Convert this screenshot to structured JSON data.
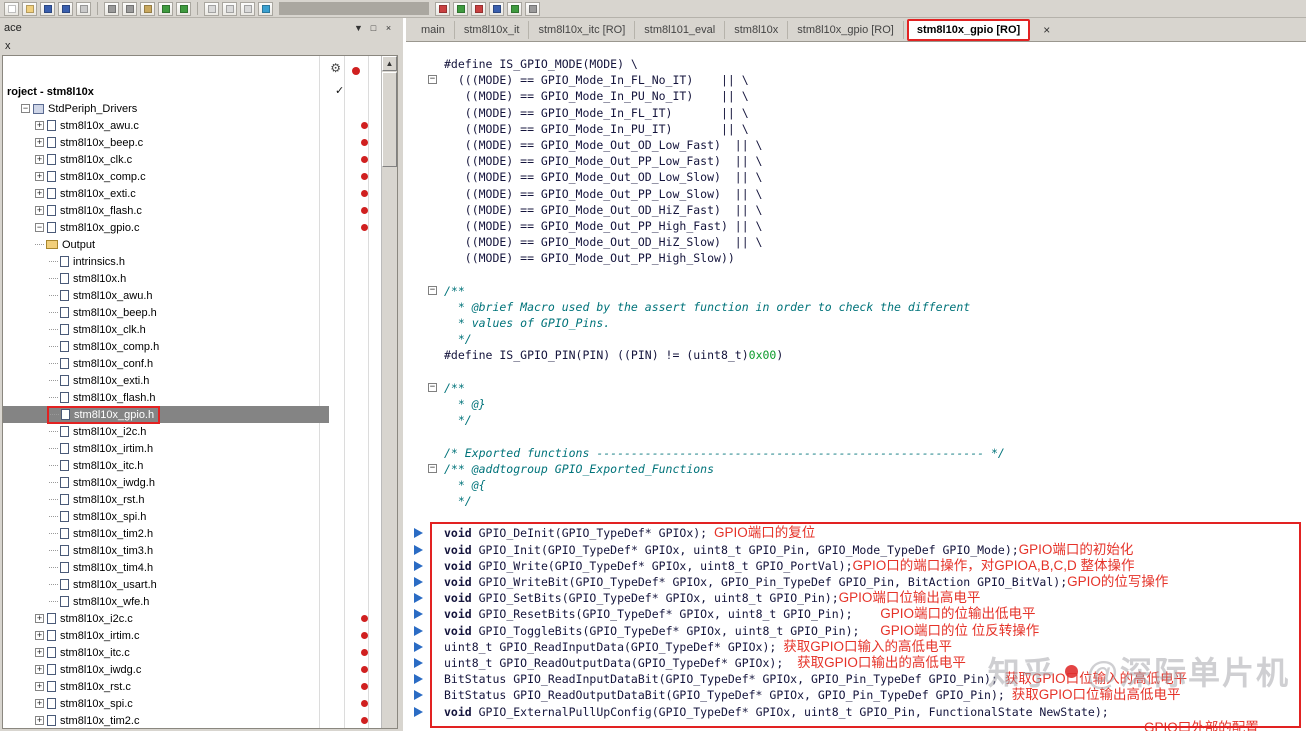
{
  "icons": {
    "dropdown": "▼",
    "pin": "□",
    "close": "×",
    "gear": "⚙",
    "check": "✓",
    "scroll_up": "▲",
    "tab_close": "×"
  },
  "toolbar": {
    "groups": [
      {
        "icons": [
          {
            "n": "new-document-icon",
            "c": "#ffffff"
          },
          {
            "n": "open-file-icon",
            "c": "#f0cf7e"
          },
          {
            "n": "save-icon",
            "c": "#3a5fae"
          },
          {
            "n": "save-all-icon",
            "c": "#3a5fae"
          },
          {
            "n": "print-icon",
            "c": "#c9c9c9"
          }
        ]
      },
      {
        "icons": [
          {
            "n": "cut-icon",
            "c": "#9a9a9a"
          },
          {
            "n": "copy-icon",
            "c": "#9a9a9a"
          },
          {
            "n": "paste-icon",
            "c": "#c9a85e"
          },
          {
            "n": "undo-icon",
            "c": "#3f9b3f"
          },
          {
            "n": "redo-icon",
            "c": "#3f9b3f"
          }
        ]
      },
      {
        "icons": [
          {
            "n": "find-icon",
            "c": "#d9d9d9"
          },
          {
            "n": "replace-icon",
            "c": "#d9d9d9"
          },
          {
            "n": "find-next-icon",
            "c": "#d9d9d9"
          },
          {
            "n": "bookmark-icon",
            "c": "#3aa0d0"
          }
        ]
      },
      {
        "gap": true,
        "icons": [
          {
            "n": "make-build-icon",
            "c": "#c94040"
          },
          {
            "n": "compile-icon",
            "c": "#3f9b3f"
          },
          {
            "n": "stop-build-icon",
            "c": "#c94040"
          },
          {
            "n": "download-debug-icon",
            "c": "#3a5fae"
          },
          {
            "n": "debug-icon",
            "c": "#3f9b3f"
          },
          {
            "n": "settings-icon",
            "c": "#9a9a9a"
          }
        ]
      }
    ]
  },
  "workspace": {
    "panel_title": "ace",
    "sub_label": "x",
    "tree": [
      {
        "label": "roject - stm8l10x",
        "depth": 0,
        "box": "",
        "icon": "",
        "bold": true,
        "check": true
      },
      {
        "label": "StdPeriph_Drivers",
        "depth": 1,
        "box": "-",
        "icon": "group"
      },
      {
        "label": "stm8l10x_awu.c",
        "depth": 2,
        "box": "+",
        "icon": "file",
        "dot": true
      },
      {
        "label": "stm8l10x_beep.c",
        "depth": 2,
        "box": "+",
        "icon": "file",
        "dot": true
      },
      {
        "label": "stm8l10x_clk.c",
        "depth": 2,
        "box": "+",
        "icon": "file",
        "dot": true
      },
      {
        "label": "stm8l10x_comp.c",
        "depth": 2,
        "box": "+",
        "icon": "file",
        "dot": true
      },
      {
        "label": "stm8l10x_exti.c",
        "depth": 2,
        "box": "+",
        "icon": "file",
        "dot": true
      },
      {
        "label": "stm8l10x_flash.c",
        "depth": 2,
        "box": "+",
        "icon": "file",
        "dot": true
      },
      {
        "label": "stm8l10x_gpio.c",
        "depth": 2,
        "box": "-",
        "icon": "file",
        "dot": true
      },
      {
        "label": "Output",
        "depth": 2,
        "box": "",
        "icon": "folder"
      },
      {
        "label": "intrinsics.h",
        "depth": 3,
        "box": "",
        "icon": "file"
      },
      {
        "label": "stm8l10x.h",
        "depth": 3,
        "box": "",
        "icon": "file"
      },
      {
        "label": "stm8l10x_awu.h",
        "depth": 3,
        "box": "",
        "icon": "file"
      },
      {
        "label": "stm8l10x_beep.h",
        "depth": 3,
        "box": "",
        "icon": "file"
      },
      {
        "label": "stm8l10x_clk.h",
        "depth": 3,
        "box": "",
        "icon": "file"
      },
      {
        "label": "stm8l10x_comp.h",
        "depth": 3,
        "box": "",
        "icon": "file"
      },
      {
        "label": "stm8l10x_conf.h",
        "depth": 3,
        "box": "",
        "icon": "file"
      },
      {
        "label": "stm8l10x_exti.h",
        "depth": 3,
        "box": "",
        "icon": "file"
      },
      {
        "label": "stm8l10x_flash.h",
        "depth": 3,
        "box": "",
        "icon": "file"
      },
      {
        "label": "stm8l10x_gpio.h",
        "depth": 3,
        "box": "",
        "icon": "file",
        "sel": true,
        "redbox": true
      },
      {
        "label": "stm8l10x_i2c.h",
        "depth": 3,
        "box": "",
        "icon": "file"
      },
      {
        "label": "stm8l10x_irtim.h",
        "depth": 3,
        "box": "",
        "icon": "file"
      },
      {
        "label": "stm8l10x_itc.h",
        "depth": 3,
        "box": "",
        "icon": "file"
      },
      {
        "label": "stm8l10x_iwdg.h",
        "depth": 3,
        "box": "",
        "icon": "file"
      },
      {
        "label": "stm8l10x_rst.h",
        "depth": 3,
        "box": "",
        "icon": "file"
      },
      {
        "label": "stm8l10x_spi.h",
        "depth": 3,
        "box": "",
        "icon": "file"
      },
      {
        "label": "stm8l10x_tim2.h",
        "depth": 3,
        "box": "",
        "icon": "file"
      },
      {
        "label": "stm8l10x_tim3.h",
        "depth": 3,
        "box": "",
        "icon": "file"
      },
      {
        "label": "stm8l10x_tim4.h",
        "depth": 3,
        "box": "",
        "icon": "file"
      },
      {
        "label": "stm8l10x_usart.h",
        "depth": 3,
        "box": "",
        "icon": "file"
      },
      {
        "label": "stm8l10x_wfe.h",
        "depth": 3,
        "box": "",
        "icon": "file"
      },
      {
        "label": "stm8l10x_i2c.c",
        "depth": 2,
        "box": "+",
        "icon": "file",
        "dot": true
      },
      {
        "label": "stm8l10x_irtim.c",
        "depth": 2,
        "box": "+",
        "icon": "file",
        "dot": true
      },
      {
        "label": "stm8l10x_itc.c",
        "depth": 2,
        "box": "+",
        "icon": "file",
        "dot": true
      },
      {
        "label": "stm8l10x_iwdg.c",
        "depth": 2,
        "box": "+",
        "icon": "file",
        "dot": true
      },
      {
        "label": "stm8l10x_rst.c",
        "depth": 2,
        "box": "+",
        "icon": "file",
        "dot": true
      },
      {
        "label": "stm8l10x_spi.c",
        "depth": 2,
        "box": "+",
        "icon": "file",
        "dot": true
      },
      {
        "label": "stm8l10x_tim2.c",
        "depth": 2,
        "box": "+",
        "icon": "file",
        "dot": true
      }
    ]
  },
  "editor": {
    "tabs": [
      {
        "label": "main"
      },
      {
        "label": "stm8l10x_it"
      },
      {
        "label": "stm8l10x_itc [RO]"
      },
      {
        "label": "stm8l101_eval"
      },
      {
        "label": "stm8l10x"
      },
      {
        "label": "stm8l10x_gpio [RO]"
      },
      {
        "label": "stm8l10x_gpio [RO]",
        "active": true
      }
    ],
    "lines": [
      {
        "g": "",
        "s": [
          [
            "#define IS_GPIO_MODE(MODE) \\",
            "c"
          ]
        ]
      },
      {
        "g": "fold",
        "s": [
          [
            "  (((MODE) == GPIO_Mode_In_FL_No_IT)    || \\",
            "c"
          ]
        ]
      },
      {
        "g": "",
        "s": [
          [
            "   ((MODE) == GPIO_Mode_In_PU_No_IT)    || \\",
            "c"
          ]
        ]
      },
      {
        "g": "",
        "s": [
          [
            "   ((MODE) == GPIO_Mode_In_FL_IT)       || \\",
            "c"
          ]
        ]
      },
      {
        "g": "",
        "s": [
          [
            "   ((MODE) == GPIO_Mode_In_PU_IT)       || \\",
            "c"
          ]
        ]
      },
      {
        "g": "",
        "s": [
          [
            "   ((MODE) == GPIO_Mode_Out_OD_Low_Fast)  || \\",
            "c"
          ]
        ]
      },
      {
        "g": "",
        "s": [
          [
            "   ((MODE) == GPIO_Mode_Out_PP_Low_Fast)  || \\",
            "c"
          ]
        ]
      },
      {
        "g": "",
        "s": [
          [
            "   ((MODE) == GPIO_Mode_Out_OD_Low_Slow)  || \\",
            "c"
          ]
        ]
      },
      {
        "g": "",
        "s": [
          [
            "   ((MODE) == GPIO_Mode_Out_PP_Low_Slow)  || \\",
            "c"
          ]
        ]
      },
      {
        "g": "",
        "s": [
          [
            "   ((MODE) == GPIO_Mode_Out_OD_HiZ_Fast)  || \\",
            "c"
          ]
        ]
      },
      {
        "g": "",
        "s": [
          [
            "   ((MODE) == GPIO_Mode_Out_PP_High_Fast) || \\",
            "c"
          ]
        ]
      },
      {
        "g": "",
        "s": [
          [
            "   ((MODE) == GPIO_Mode_Out_OD_HiZ_Slow)  || \\",
            "c"
          ]
        ]
      },
      {
        "g": "",
        "s": [
          [
            "   ((MODE) == GPIO_Mode_Out_PP_High_Slow))",
            "c"
          ]
        ]
      },
      {
        "g": ""
      },
      {
        "g": "fold",
        "s": [
          [
            "/**",
            "cm"
          ]
        ]
      },
      {
        "g": "",
        "s": [
          [
            "  * @brief Macro used by the assert function in order to check the different",
            "cm"
          ]
        ]
      },
      {
        "g": "",
        "s": [
          [
            "  * values of GPIO_Pins.",
            "cm"
          ]
        ]
      },
      {
        "g": "",
        "s": [
          [
            "  */",
            "cm"
          ]
        ]
      },
      {
        "g": "",
        "s": [
          [
            "#define IS_GPIO_PIN(PIN) ((PIN) != (uint8_t)",
            "c"
          ],
          [
            "0x00",
            "num"
          ],
          [
            ")",
            "c"
          ]
        ]
      },
      {
        "g": ""
      },
      {
        "g": "fold",
        "s": [
          [
            "/**",
            "cm"
          ]
        ]
      },
      {
        "g": "",
        "s": [
          [
            "  * @}",
            "cm"
          ]
        ]
      },
      {
        "g": "",
        "s": [
          [
            "  */",
            "cm"
          ]
        ]
      },
      {
        "g": ""
      },
      {
        "g": "",
        "s": [
          [
            "/* Exported functions -------------------------------------------------------- */",
            "cm"
          ]
        ]
      },
      {
        "g": "fold",
        "s": [
          [
            "/** @addtogroup GPIO_Exported_Functions",
            "cm"
          ]
        ]
      },
      {
        "g": "",
        "s": [
          [
            "  * @{",
            "cm"
          ]
        ]
      },
      {
        "g": "",
        "s": [
          [
            "  */",
            "cm"
          ]
        ]
      },
      {
        "g": ""
      },
      {
        "g": "arrow",
        "s": [
          [
            "void",
            "kw"
          ],
          [
            " GPIO_DeInit(GPIO_TypeDef* GPIOx); ",
            "c"
          ],
          [
            "GPIO端口的复位",
            "cn"
          ]
        ]
      },
      {
        "g": "arrow",
        "s": [
          [
            "void",
            "kw"
          ],
          [
            " GPIO_Init(GPIO_TypeDef* GPIOx, uint8_t GPIO_Pin, GPIO_Mode_TypeDef GPIO_Mode);",
            "c"
          ],
          [
            "GPIO端口的初始化",
            "cn"
          ]
        ]
      },
      {
        "g": "arrow",
        "s": [
          [
            "void",
            "kw"
          ],
          [
            " GPIO_Write(GPIO_TypeDef* GPIOx, uint8_t GPIO_PortVal);",
            "c"
          ],
          [
            "GPIO口的端口操作，对GPIOA,B,C,D 整体操作",
            "cn"
          ]
        ]
      },
      {
        "g": "arrow",
        "s": [
          [
            "void",
            "kw"
          ],
          [
            " GPIO_WriteBit(GPIO_TypeDef* GPIOx, GPIO_Pin_TypeDef GPIO_Pin, BitAction GPIO_BitVal);",
            "c"
          ],
          [
            "GPIO的位写操作",
            "cn"
          ]
        ]
      },
      {
        "g": "arrow",
        "s": [
          [
            "void",
            "kw"
          ],
          [
            " GPIO_SetBits(GPIO_TypeDef* GPIOx, uint8_t GPIO_Pin);",
            "c"
          ],
          [
            "GPIO端口位输出高电平",
            "cn"
          ]
        ]
      },
      {
        "g": "arrow",
        "s": [
          [
            "void",
            "kw"
          ],
          [
            " GPIO_ResetBits(GPIO_TypeDef* GPIOx, uint8_t GPIO_Pin);    ",
            "c"
          ],
          [
            "GPIO端口的位输出低电平",
            "cn"
          ]
        ]
      },
      {
        "g": "arrow",
        "s": [
          [
            "void",
            "kw"
          ],
          [
            " GPIO_ToggleBits(GPIO_TypeDef* GPIOx, uint8_t GPIO_Pin);   ",
            "c"
          ],
          [
            "GPIO端口的位 位反转操作",
            "cn"
          ]
        ]
      },
      {
        "g": "arrow",
        "s": [
          [
            "uint8_t GPIO_ReadInputData(GPIO_TypeDef* GPIOx); ",
            "c"
          ],
          [
            "获取GPIO口输入的高低电平",
            "cn"
          ]
        ]
      },
      {
        "g": "arrow",
        "s": [
          [
            "uint8_t GPIO_ReadOutputData(GPIO_TypeDef* GPIOx);  ",
            "c"
          ],
          [
            "获取GPIO口输出的高低电平",
            "cn"
          ]
        ]
      },
      {
        "g": "arrow",
        "s": [
          [
            "BitStatus GPIO_ReadInputDataBit(GPIO_TypeDef* GPIOx, GPIO_Pin_TypeDef GPIO_Pin); ",
            "c"
          ],
          [
            "获取GPIO口位输入的高低电平",
            "cn"
          ]
        ]
      },
      {
        "g": "arrow",
        "s": [
          [
            "BitStatus GPIO_ReadOutputDataBit(GPIO_TypeDef* GPIOx, GPIO_Pin_TypeDef GPIO_Pin); ",
            "c"
          ],
          [
            "获取GPIO口位输出高低电平",
            "cn"
          ]
        ]
      },
      {
        "g": "arrow",
        "s": [
          [
            "void",
            "kw"
          ],
          [
            " GPIO_ExternalPullUpConfig(GPIO_TypeDef* GPIOx, uint8_t GPIO_Pin, FunctionalState NewState);",
            "c"
          ]
        ]
      },
      {
        "g": "",
        "pad": 700,
        "s": [
          [
            "GPIO口外部的配置",
            "cn"
          ]
        ]
      }
    ]
  },
  "watermark": {
    "prefix": "知乎",
    "name_at": "@深际单片机"
  }
}
